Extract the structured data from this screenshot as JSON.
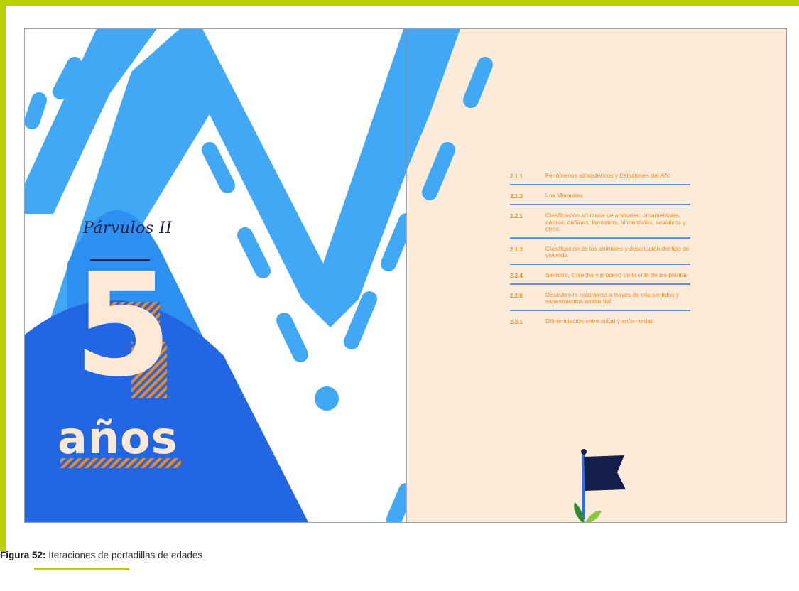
{
  "colors": {
    "frame": "#b9d000",
    "blue_light": "#40a8f5",
    "blue_mid": "#2d8ff0",
    "blue_dark": "#2366e3",
    "cream": "#fdebd9",
    "navy": "#14204a",
    "orange": "#f08a1c"
  },
  "cover": {
    "level_title": "Párvulos II",
    "age_number": "5",
    "age_word": "años"
  },
  "toc": {
    "items": [
      {
        "num": "2.1.1",
        "text": "Fenómenos atmosféricos y Estaciones del Año"
      },
      {
        "num": "2.1.3",
        "text": "Los Minerales"
      },
      {
        "num": "2.2.1",
        "text": "Clasificación arbitraria de animales: ornamentales, aéreos, dañinos, terrestres, alimenticios, acuáticos y otros."
      },
      {
        "num": "2.1.3",
        "text": "Clasificación de los animales y descripción del tipo de vivienda"
      },
      {
        "num": "2.2.4",
        "text": "Siembra, cosecha y proceso de la vida de las plantas"
      },
      {
        "num": "2.2.6",
        "text": "Descubro la naturaleza a través de mis sentidos y saneamientos ambiental"
      },
      {
        "num": "2.3.1",
        "text": "Diferenciación entre salud y enfermedad"
      }
    ]
  },
  "caption": {
    "label": "Figura 52:",
    "text": " Iteraciones de portadillas de edades"
  },
  "icons": {
    "flag": "flag-icon",
    "sprout": "sprout-icon"
  }
}
